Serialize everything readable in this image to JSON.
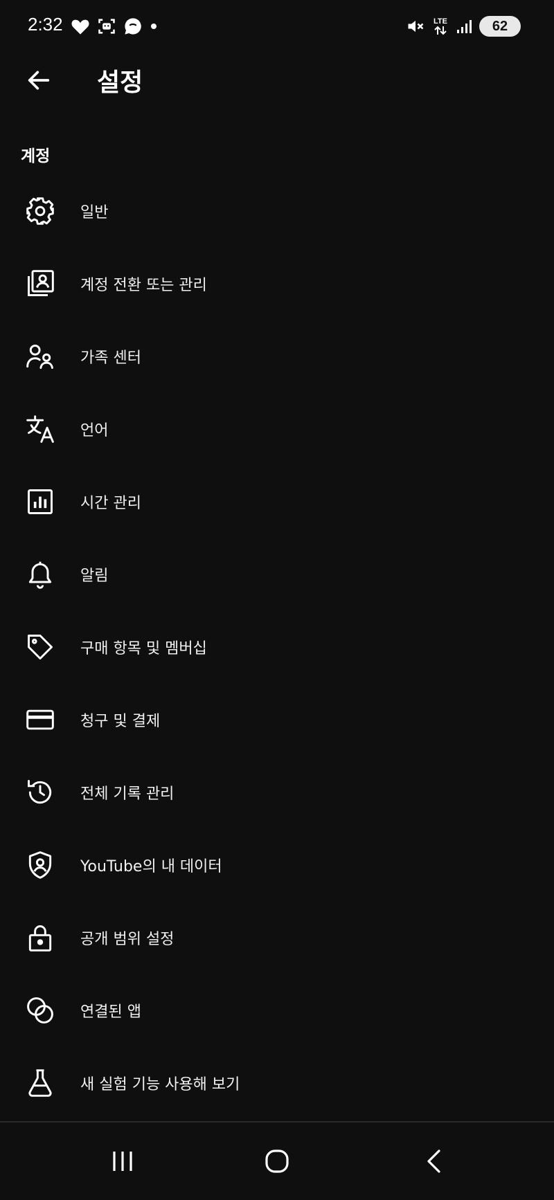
{
  "status_bar": {
    "time": "2:32",
    "battery_level": "62",
    "network": "LTE",
    "icons_left": [
      "heart-icon",
      "face-scan-icon",
      "chat-bubble-icon",
      "dot-icon"
    ],
    "icons_right": [
      "mute-icon",
      "lte-icon",
      "signal-icon",
      "battery-icon"
    ]
  },
  "header": {
    "back_icon": "arrow-left-icon",
    "title": "설정"
  },
  "section": {
    "title": "계정"
  },
  "menu": {
    "items": [
      {
        "label": "일반",
        "icon": "gear-icon"
      },
      {
        "label": "계정 전환 또는 관리",
        "icon": "account-switch-icon"
      },
      {
        "label": "가족 센터",
        "icon": "family-icon"
      },
      {
        "label": "언어",
        "icon": "translate-icon"
      },
      {
        "label": "시간 관리",
        "icon": "bar-chart-icon"
      },
      {
        "label": "알림",
        "icon": "bell-icon"
      },
      {
        "label": "구매 항목 및 멤버십",
        "icon": "tag-icon"
      },
      {
        "label": "청구 및 결제",
        "icon": "credit-card-icon"
      },
      {
        "label": "전체 기록 관리",
        "icon": "history-icon"
      },
      {
        "label": "YouTube의 내 데이터",
        "icon": "shield-person-icon"
      },
      {
        "label": "공개 범위 설정",
        "icon": "lock-icon"
      },
      {
        "label": "연결된 앱",
        "icon": "linked-circles-icon"
      },
      {
        "label": "새 실험 기능 사용해 보기",
        "icon": "flask-icon"
      }
    ]
  },
  "nav_bar": {
    "buttons": [
      "recent-apps-icon",
      "home-icon",
      "back-icon"
    ]
  },
  "colors": {
    "background": "#0f0f0f",
    "text": "#ffffff"
  }
}
